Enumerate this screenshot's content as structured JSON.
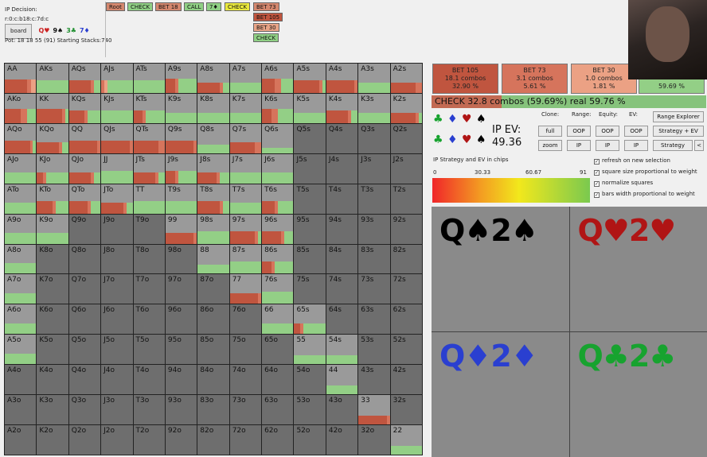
{
  "info": {
    "decision": "IP Decision:",
    "board_string": "r:0:c:b18:c:7d:c",
    "board_button": "board",
    "board_cards": [
      {
        "text": "Q♥",
        "color": "#cc2222"
      },
      {
        "text": "9♠",
        "color": "#111111"
      },
      {
        "text": "3♣",
        "color": "#1f8f2f"
      },
      {
        "text": "7♦",
        "color": "#2a3fd0"
      }
    ],
    "pot_line": "Pot: 18 18 55 (91) Starting Stacks:740"
  },
  "action_tree": [
    {
      "label": "Root",
      "color": "#d4876e"
    },
    {
      "label": "CHECK",
      "color": "#8fcf84"
    },
    {
      "label": "BET 18",
      "color": "#d4876e"
    },
    {
      "label": "CALL",
      "color": "#8fcf84"
    },
    {
      "label": "7♦",
      "color": "#8fcf84"
    },
    {
      "label": "CHECK",
      "color": "#e9e83c"
    },
    {
      "label": "BET 73",
      "color": "#d4876e"
    },
    {
      "label": "BET 105",
      "color": "#c0553f"
    },
    {
      "label": "BET 30",
      "color": "#e8a487"
    },
    {
      "label": "CHECK",
      "color": "#8fcf84"
    }
  ],
  "grid": {
    "rows": [
      [
        "AA",
        "AKs",
        "AQs",
        "AJs",
        "ATs",
        "A9s",
        "A8s",
        "A7s",
        "A6s",
        "A5s",
        "A4s",
        "A3s",
        "A2s"
      ],
      [
        "AKo",
        "KK",
        "KQs",
        "KJs",
        "KTs",
        "K9s",
        "K8s",
        "K7s",
        "K6s",
        "K5s",
        "K4s",
        "K3s",
        "K2s"
      ],
      [
        "AQo",
        "KQo",
        "QQ",
        "QJs",
        "QTs",
        "Q9s",
        "Q8s",
        "Q7s",
        "Q6s",
        "Q5s",
        "Q4s",
        "Q3s",
        "Q2s"
      ],
      [
        "AJo",
        "KJo",
        "QJo",
        "JJ",
        "JTs",
        "J9s",
        "J8s",
        "J7s",
        "J6s",
        "J5s",
        "J4s",
        "J3s",
        "J2s"
      ],
      [
        "ATo",
        "KTo",
        "QTo",
        "JTo",
        "TT",
        "T9s",
        "T8s",
        "T7s",
        "T6s",
        "T5s",
        "T4s",
        "T3s",
        "T2s"
      ],
      [
        "A9o",
        "K9o",
        "Q9o",
        "J9o",
        "T9o",
        "99",
        "98s",
        "97s",
        "96s",
        "95s",
        "94s",
        "93s",
        "92s"
      ],
      [
        "A8o",
        "K8o",
        "Q8o",
        "J8o",
        "T8o",
        "98o",
        "88",
        "87s",
        "86s",
        "85s",
        "84s",
        "83s",
        "82s"
      ],
      [
        "A7o",
        "K7o",
        "Q7o",
        "J7o",
        "T7o",
        "97o",
        "87o",
        "77",
        "76s",
        "75s",
        "74s",
        "73s",
        "72s"
      ],
      [
        "A6o",
        "K6o",
        "Q6o",
        "J6o",
        "T6o",
        "96o",
        "86o",
        "76o",
        "66",
        "65s",
        "64s",
        "63s",
        "62s"
      ],
      [
        "A5o",
        "K5o",
        "Q5o",
        "J5o",
        "T5o",
        "95o",
        "85o",
        "75o",
        "65o",
        "55",
        "54s",
        "53s",
        "52s"
      ],
      [
        "A4o",
        "K4o",
        "Q4o",
        "J4o",
        "T4o",
        "94o",
        "84o",
        "74o",
        "64o",
        "54o",
        "44",
        "43s",
        "42s"
      ],
      [
        "A3o",
        "K3o",
        "Q3o",
        "J3o",
        "T3o",
        "93o",
        "83o",
        "73o",
        "63o",
        "53o",
        "43o",
        "33",
        "32s"
      ],
      [
        "A2o",
        "K2o",
        "Q2o",
        "J2o",
        "T2o",
        "92o",
        "82o",
        "72o",
        "62o",
        "52o",
        "42o",
        "32o",
        "22"
      ]
    ],
    "colors": {
      "check": "#93cf86",
      "bet105": "#c0553f",
      "bet73": "#d6745c",
      "bet30": "#eba184"
    },
    "hands": {
      "AA": {
        "w": 0.75,
        "mix": [
          0.0,
          0.7,
          0.15,
          0.15
        ]
      },
      "AKs": {
        "w": 0.7,
        "mix": [
          1,
          0,
          0,
          0
        ]
      },
      "AQs": {
        "w": 0.7,
        "mix": [
          0.2,
          0.7,
          0.1,
          0
        ]
      },
      "AJs": {
        "w": 0.7,
        "mix": [
          0.8,
          0,
          0.1,
          0.1
        ]
      },
      "ATs": {
        "w": 0.7,
        "mix": [
          1,
          0,
          0,
          0
        ]
      },
      "A9s": {
        "w": 0.8,
        "mix": [
          0.6,
          0.3,
          0.1,
          0
        ]
      },
      "A8s": {
        "w": 0.6,
        "mix": [
          0.2,
          0.7,
          0.1,
          0
        ]
      },
      "A7s": {
        "w": 0.6,
        "mix": [
          1,
          0,
          0,
          0
        ]
      },
      "A6s": {
        "w": 0.8,
        "mix": [
          0.4,
          0.4,
          0.2,
          0
        ]
      },
      "A5s": {
        "w": 0.7,
        "mix": [
          0.1,
          0.8,
          0.1,
          0
        ]
      },
      "A4s": {
        "w": 0.7,
        "mix": [
          0,
          0.9,
          0.1,
          0
        ]
      },
      "A3s": {
        "w": 0.6,
        "mix": [
          1,
          0,
          0,
          0
        ]
      },
      "A2s": {
        "w": 0.6,
        "mix": [
          0,
          0.8,
          0.2,
          0
        ]
      },
      "AKo": {
        "w": 0.8,
        "mix": [
          0.3,
          0.5,
          0.2,
          0
        ]
      },
      "KK": {
        "w": 0.8,
        "mix": [
          0.1,
          0.8,
          0.1,
          0
        ]
      },
      "KQs": {
        "w": 0.7,
        "mix": [
          0.4,
          0.5,
          0.1,
          0
        ]
      },
      "KJs": {
        "w": 0.7,
        "mix": [
          1,
          0,
          0,
          0
        ]
      },
      "KTs": {
        "w": 0.7,
        "mix": [
          0.6,
          0.3,
          0.1,
          0
        ]
      },
      "K9s": {
        "w": 0.6,
        "mix": [
          1,
          0,
          0,
          0
        ]
      },
      "K8s": {
        "w": 0.6,
        "mix": [
          1,
          0,
          0,
          0
        ]
      },
      "K7s": {
        "w": 0.6,
        "mix": [
          1,
          0,
          0,
          0
        ]
      },
      "K6s": {
        "w": 0.8,
        "mix": [
          0.5,
          0.3,
          0.2,
          0
        ]
      },
      "K5s": {
        "w": 0.6,
        "mix": [
          1,
          0,
          0,
          0
        ]
      },
      "K4s": {
        "w": 0.7,
        "mix": [
          0.2,
          0.7,
          0.1,
          0
        ]
      },
      "K3s": {
        "w": 0.6,
        "mix": [
          1,
          0,
          0,
          0
        ]
      },
      "K2s": {
        "w": 0.6,
        "mix": [
          0.1,
          0.8,
          0.1,
          0
        ]
      },
      "AQo": {
        "w": 0.7,
        "mix": [
          0.1,
          0.8,
          0.1,
          0
        ]
      },
      "KQo": {
        "w": 0.6,
        "mix": [
          0.2,
          0.7,
          0.1,
          0
        ]
      },
      "QQ": {
        "w": 0.7,
        "mix": [
          0,
          0.9,
          0.1,
          0
        ]
      },
      "QJs": {
        "w": 0.7,
        "mix": [
          0,
          0.9,
          0.1,
          0
        ]
      },
      "QTs": {
        "w": 0.7,
        "mix": [
          0,
          0.8,
          0.2,
          0
        ]
      },
      "Q9s": {
        "w": 0.7,
        "mix": [
          0,
          0.9,
          0.1,
          0
        ]
      },
      "Q8s": {
        "w": 0.5,
        "mix": [
          1,
          0,
          0,
          0
        ]
      },
      "Q7s": {
        "w": 0.6,
        "mix": [
          0,
          0.8,
          0.2,
          0
        ]
      },
      "Q6s": {
        "w": 0.3,
        "mix": [
          1,
          0,
          0,
          0
        ]
      },
      "AJo": {
        "w": 0.6,
        "mix": [
          1,
          0,
          0,
          0
        ]
      },
      "KJo": {
        "w": 0.6,
        "mix": [
          0.7,
          0.2,
          0.1,
          0
        ]
      },
      "QJo": {
        "w": 0.6,
        "mix": [
          0.2,
          0.7,
          0.1,
          0
        ]
      },
      "JJ": {
        "w": 0.7,
        "mix": [
          1,
          0,
          0,
          0
        ]
      },
      "JTs": {
        "w": 0.6,
        "mix": [
          0.2,
          0.7,
          0.1,
          0
        ]
      },
      "J9s": {
        "w": 0.7,
        "mix": [
          0.6,
          0.3,
          0.1,
          0
        ]
      },
      "J8s": {
        "w": 0.6,
        "mix": [
          0.3,
          0.6,
          0.1,
          0
        ]
      },
      "J7s": {
        "w": 0.6,
        "mix": [
          1,
          0,
          0,
          0
        ]
      },
      "J6s": {
        "w": 0.6,
        "mix": [
          1,
          0,
          0,
          0
        ]
      },
      "ATo": {
        "w": 0.6,
        "mix": [
          1,
          0,
          0,
          0
        ]
      },
      "KTo": {
        "w": 0.7,
        "mix": [
          0.4,
          0.5,
          0.1,
          0
        ]
      },
      "QTo": {
        "w": 0.7,
        "mix": [
          0.3,
          0.6,
          0.1,
          0
        ]
      },
      "JTo": {
        "w": 0.6,
        "mix": [
          0.2,
          0.7,
          0.1,
          0
        ]
      },
      "TT": {
        "w": 0.7,
        "mix": [
          1,
          0,
          0,
          0
        ]
      },
      "T9s": {
        "w": 0.7,
        "mix": [
          1,
          0,
          0,
          0
        ]
      },
      "T8s": {
        "w": 0.7,
        "mix": [
          0.2,
          0.7,
          0.1,
          0
        ]
      },
      "T7s": {
        "w": 0.6,
        "mix": [
          1,
          0,
          0,
          0
        ]
      },
      "T6s": {
        "w": 0.7,
        "mix": [
          0.5,
          0.4,
          0.1,
          0
        ]
      },
      "A9o": {
        "w": 0.6,
        "mix": [
          1,
          0,
          0,
          0
        ]
      },
      "K9o": {
        "w": 0.6,
        "mix": [
          1,
          0,
          0,
          0
        ]
      },
      "99": {
        "w": 0.6,
        "mix": [
          0,
          0.9,
          0.1,
          0
        ]
      },
      "98s": {
        "w": 0.7,
        "mix": [
          1,
          0,
          0,
          0
        ]
      },
      "97s": {
        "w": 0.7,
        "mix": [
          0.1,
          0.8,
          0.1,
          0
        ]
      },
      "96s": {
        "w": 0.7,
        "mix": [
          0.3,
          0.6,
          0.1,
          0
        ]
      },
      "A8o": {
        "w": 0.6,
        "mix": [
          1,
          0,
          0,
          0
        ]
      },
      "88": {
        "w": 0.5,
        "mix": [
          1,
          0,
          0,
          0
        ]
      },
      "87s": {
        "w": 0.7,
        "mix": [
          1,
          0,
          0,
          0
        ]
      },
      "86s": {
        "w": 0.7,
        "mix": [
          0.6,
          0.3,
          0.1,
          0
        ]
      },
      "A7o": {
        "w": 0.6,
        "mix": [
          1,
          0,
          0,
          0
        ]
      },
      "77": {
        "w": 0.6,
        "mix": [
          0,
          0.9,
          0.1,
          0
        ]
      },
      "76s": {
        "w": 0.7,
        "mix": [
          1,
          0,
          0,
          0
        ]
      },
      "A6o": {
        "w": 0.6,
        "mix": [
          1,
          0,
          0,
          0
        ]
      },
      "66": {
        "w": 0.6,
        "mix": [
          1,
          0,
          0,
          0
        ]
      },
      "65s": {
        "w": 0.6,
        "mix": [
          0.7,
          0.2,
          0.1,
          0
        ]
      },
      "A5o": {
        "w": 0.6,
        "mix": [
          1,
          0,
          0,
          0
        ]
      },
      "55": {
        "w": 0.5,
        "mix": [
          1,
          0,
          0,
          0
        ]
      },
      "54s": {
        "w": 0.5,
        "mix": [
          1,
          0,
          0,
          0
        ]
      },
      "44": {
        "w": 0.5,
        "mix": [
          1,
          0,
          0,
          0
        ]
      },
      "33": {
        "w": 0.5,
        "mix": [
          0,
          0.9,
          0.1,
          0
        ]
      },
      "22": {
        "w": 0.5,
        "mix": [
          1,
          0,
          0,
          0
        ]
      }
    }
  },
  "summary": [
    {
      "name": "BET 105",
      "combos": "18.1 combos",
      "pct": "32.90 %",
      "color": "#c0553f"
    },
    {
      "name": "BET 73",
      "combos": "3.1 combos",
      "pct": "5.61 %",
      "color": "#d6745c"
    },
    {
      "name": "BET 30",
      "combos": "1.0 combos",
      "pct": "1.81 %",
      "color": "#eba184"
    },
    {
      "name": "",
      "combos": "",
      "pct": "59.69 %",
      "color": "#93cf86"
    }
  ],
  "check_bar": "CHECK  32.8 combos (59.69%) real  59.76 %",
  "ev": {
    "label": "IP EV:",
    "value": "49.36"
  },
  "controls": {
    "clone": "Clone:",
    "range": "Range:",
    "equity": "Equity:",
    "ev": "EV:",
    "full": "full",
    "zoom": "zoom",
    "oop": "OOP",
    "ip": "IP",
    "range_explorer": "Range Explorer",
    "strategy_ev": "Strategy + EV",
    "strategy": "Strategy",
    "less": "<"
  },
  "checkboxes": [
    {
      "label": "refresh on new selection",
      "checked": true
    },
    {
      "label": "square size proportional to weight",
      "checked": true
    },
    {
      "label": "normalize squares",
      "checked": true
    },
    {
      "label": "bars width proportional to weight",
      "checked": true
    }
  ],
  "strategy_label": "IP Strategy and EV in chips",
  "scale": {
    "min": "0",
    "q1": "30.33",
    "q2": "60.67",
    "max": "91"
  },
  "combos": [
    {
      "cards": "Q♠2♠",
      "color": "#000000"
    },
    {
      "cards": "Q♥2♥",
      "color": "#b01515"
    },
    {
      "cards": "Q♦2♦",
      "color": "#2a3fd0"
    },
    {
      "cards": "Q♣2♣",
      "color": "#17a32f"
    }
  ]
}
